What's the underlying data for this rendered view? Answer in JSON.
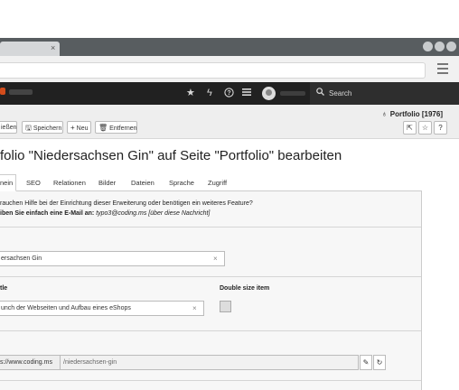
{
  "browser": {
    "tab_close": "×"
  },
  "topbar": {
    "search_placeholder": "Search",
    "icons": [
      "star-icon",
      "bolt-icon",
      "help-icon",
      "list-icon",
      "user-avatar-icon",
      "search-icon"
    ]
  },
  "docheader": {
    "record_title": "Portfolio [1976]",
    "buttons": {
      "close_label": "ießen",
      "save_label": "Speichern",
      "new_label": "Neu",
      "delete_label": "Entfernen"
    }
  },
  "heading": "folio \"Niedersachsen Gin\" auf Seite \"Portfolio\" bearbeiten",
  "tabs": [
    {
      "label": "nein"
    },
    {
      "label": "SEO"
    },
    {
      "label": "Relationen"
    },
    {
      "label": "Bilder"
    },
    {
      "label": "Dateien"
    },
    {
      "label": "Sprache"
    },
    {
      "label": "Zugriff"
    }
  ],
  "info": {
    "line1": "rauchen Hilfe bei der Einrichtung dieser Erweiterung oder benötigen ein weiteres Feature?",
    "line2_bold": "iben Sie einfach eine E-Mail an:",
    "line2_rest": " typo3@coding.ms [über diese Nachricht]"
  },
  "form": {
    "title_value": "ersachsen Gin",
    "subtitle_label": "tle",
    "subtitle_value": "unch der Webseiten und Aufbau eines eShops",
    "double_size_label": "Double size item",
    "slug_prefix": "s://www.coding.ms",
    "slug_value": "/niedersachsen-gin"
  },
  "colors": {
    "topbar": "#212121",
    "browser_tabbar": "#585d60",
    "docheader": "#eeeeee",
    "panel": "#f7f7f7"
  }
}
